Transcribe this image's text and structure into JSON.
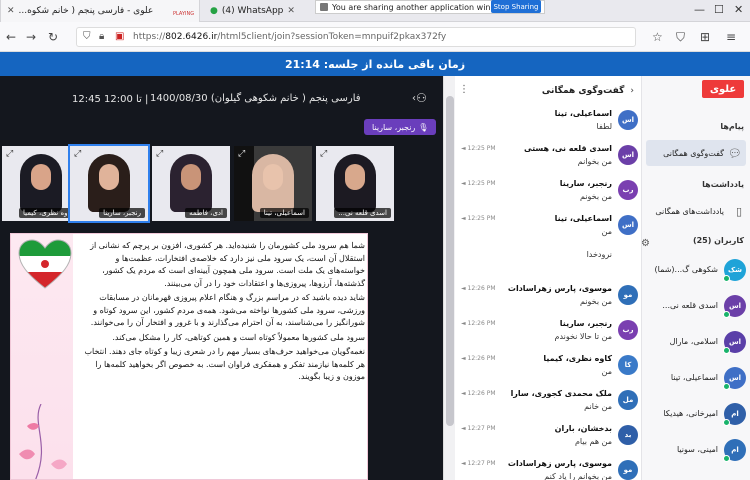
{
  "browser": {
    "tabs": [
      {
        "label": "علوی - فارسی پنجم ( خانم شکوه...",
        "sub": "PLAYING"
      },
      {
        "label": "(4) WhatsApp"
      }
    ],
    "share_notice": "You are sharing another application window.",
    "stop_sharing": "Stop Sharing",
    "url_scheme": "https://",
    "url_host": "802.6426.ir",
    "url_rest": "/html5client/join?sessionToken=mnpuif2pkax372fy"
  },
  "timer": "زمان باقی مانده از جلسه: 21:14",
  "classroom": {
    "title": "فارسی پنجم ( خانم شکوهی گیلوان) 1400/08/30",
    "time": "12:45 تا 12:00 |",
    "speaker": "رنجبر، سارینا",
    "videos": [
      {
        "name": "کاوه نظری، کیمیا"
      },
      {
        "name": "رنجبر، سارینا"
      },
      {
        "name": "ادی، فاطمه"
      },
      {
        "name": "اسماعیلی، تینا"
      },
      {
        "name": "اسدی قلعه نی..."
      }
    ],
    "doc_paragraphs": [
      "شما هم سرود ملی کشورمان را شنیده‌اید. هر کشوری، افزون بر پرچم که نشانی از استقلال آن است، یک سرود ملی نیز دارد که خلاصه‌ی افتخارات، عظمت‌ها و خواسته‌های یک ملت است. سرود ملی همچون آیینه‌ای است که مردم یک کشور، گذشته‌ها، آرزوها، پیروزی‌ها و اعتقادات خود را در آن می‌بینند.",
      "شاید دیده باشید که در مراسم بزرگ و هنگام اعلام پیروزی قهرمانان در مسابقات ورزشی، سرود ملی کشورها نواخته می‌شود. همه‌ی مردم کشور، این سرود کوتاه و شورانگیز را می‌شناسند، به آن احترام می‌گذارند و با غرور و افتخار آن را می‌خوانند.",
      "سرود ملی کشورها معمولاً کوتاه است و همین کوتاهی، کار را مشکل می‌کند.",
      "نغمه‌گویان می‌خواهید حرف‌های بسیار مهم را در شعری زیبا و کوتاه جای دهند. انتخاب هر کلمه‌ها نیازمند تفکر و همفکری فراوان است. به خصوص اگر بخواهید کلمه‌ها را موزون و زیبا بگویند."
    ]
  },
  "chat": {
    "title": "گفت‌وگوی همگانی",
    "messages": [
      {
        "initials": "اس",
        "color": "#3f6fc6",
        "name": "اسماعیلی، تینا",
        "text": "لطفا",
        "time": ""
      },
      {
        "initials": "اس",
        "color": "#6b3fa8",
        "name": "اسدی قلعه نی، هستی",
        "text": "من بخوانم",
        "time": "◄ 12:25 PM"
      },
      {
        "initials": "رب",
        "color": "#7a3fb0",
        "name": "رنجبر، سارینا",
        "text": "من بخونم",
        "time": "◄ 12:25 PM"
      },
      {
        "initials": "اس",
        "color": "#3f6fc6",
        "name": "اسماعیلی، تینا",
        "text": "من",
        "time": "◄ 12:25 PM"
      },
      {
        "initials": "",
        "color": "",
        "name": "",
        "text": "نرودخدا",
        "time": ""
      },
      {
        "initials": "مو",
        "color": "#2f6fb8",
        "name": "موسوی، پارس زهراسادات",
        "text": "من بخونم",
        "time": "◄ 12:26 PM"
      },
      {
        "initials": "رب",
        "color": "#7a3fb0",
        "name": "رنجبر، سارینا",
        "text": "من تا حالا نخوندم",
        "time": "◄ 12:26 PM"
      },
      {
        "initials": "کا",
        "color": "#3a7ac8",
        "name": "کاوه نظری، کیمیا",
        "text": "من",
        "time": "◄ 12:26 PM"
      },
      {
        "initials": "مل",
        "color": "#2f6fb8",
        "name": "ملک محمدی کجوری، سارا",
        "text": "من خانم",
        "time": "◄ 12:26 PM"
      },
      {
        "initials": "بد",
        "color": "#2f5fa8",
        "name": "بدخشان، باران",
        "text": "من هم بیام",
        "time": "◄ 12:27 PM"
      },
      {
        "initials": "مو",
        "color": "#2f6fb8",
        "name": "موسوی، پارس زهراسادات",
        "text": "من بخوانم را یاد کنم",
        "time": "◄ 12:27 PM"
      }
    ]
  },
  "sidebar": {
    "logo": "علوی",
    "messages_heading": "پیام‌ها",
    "public_chat": "گفت‌وگوی همگانی",
    "notes_heading": "یادداشت‌ها",
    "shared_notes": "یادداشت‌های همگانی",
    "users_heading": "کاربران (25)",
    "users": [
      {
        "initials": "شک",
        "color": "#1fa3d8",
        "name": "شکوهی گ...(شما)"
      },
      {
        "initials": "اس",
        "color": "#6b3fa8",
        "name": "اسدی قلعه نی..."
      },
      {
        "initials": "اس",
        "color": "#5a3fa8",
        "name": "اسلامی، مارال"
      },
      {
        "initials": "اس",
        "color": "#3f6fc6",
        "name": "اسماعیلی، تینا"
      },
      {
        "initials": "ام",
        "color": "#2f5fa8",
        "name": "امیرخانی، هیدیکا"
      },
      {
        "initials": "ام",
        "color": "#2f6fb8",
        "name": "امینی، سونیا"
      }
    ]
  }
}
